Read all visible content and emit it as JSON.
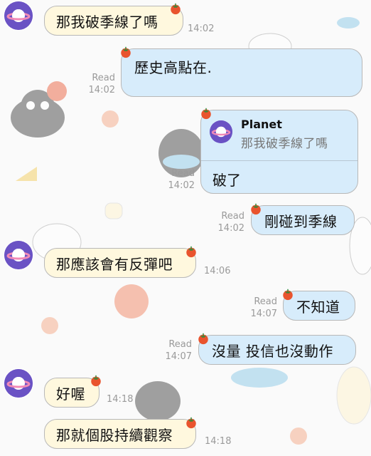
{
  "contact": {
    "name": "Planet"
  },
  "messages": [
    {
      "id": "m1",
      "side": "in",
      "text": "那我破季線了嗎",
      "time": "14:02"
    },
    {
      "id": "m2",
      "side": "out",
      "text": "歷史高點在.",
      "read": "Read",
      "time": "14:02"
    },
    {
      "id": "m3",
      "side": "out",
      "reply_to_name": "Planet",
      "reply_to_text": "那我破季線了嗎",
      "text": "破了",
      "read": "Read",
      "time": "14:02"
    },
    {
      "id": "m4",
      "side": "out",
      "text": "剛碰到季線",
      "read": "Read",
      "time": "14:02"
    },
    {
      "id": "m5",
      "side": "in",
      "text": "那應該會有反彈吧",
      "time": "14:06"
    },
    {
      "id": "m6",
      "side": "out",
      "text": "不知道",
      "read": "Read",
      "time": "14:07"
    },
    {
      "id": "m7",
      "side": "out",
      "text": "沒量 投信也沒動作",
      "read": "Read",
      "time": "14:07"
    },
    {
      "id": "m8",
      "side": "in",
      "text": "好喔",
      "time": "14:18"
    },
    {
      "id": "m9",
      "side": "in",
      "text": "那就個股持續觀察",
      "time": "14:18"
    }
  ],
  "colors": {
    "incoming_bubble": "#fff8de",
    "outgoing_bubble": "#d7ecfb",
    "avatar": "#6a52c4",
    "tomato": "#e9542e"
  }
}
